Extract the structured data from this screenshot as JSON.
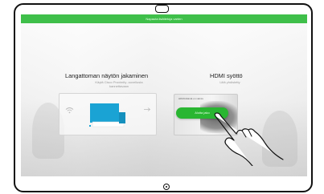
{
  "banner": {
    "text": "Napauta lisätietoja varten"
  },
  "wireless": {
    "title": "Langattoman näytön jakaminen",
    "subtitle_line1": "Käytä Cisco Proximity -sovellusta",
    "subtitle_line2": "kannettavaan"
  },
  "hdmi": {
    "title": "HDMI syöttö",
    "subtitle": "Liitä yhdistetty",
    "card_caption": "HDMI-liitäntä on valmis",
    "button_label": "Aloita jako"
  },
  "colors": {
    "accent_green": "#29b631",
    "banner_green": "#3fbf4a",
    "laptop_blue": "#1aa3d4"
  },
  "icons": {
    "wifi": "wifi-icon",
    "laptop": "laptop-icon",
    "arrow": "arrow-icon",
    "hand": "pointing-hand-icon"
  }
}
